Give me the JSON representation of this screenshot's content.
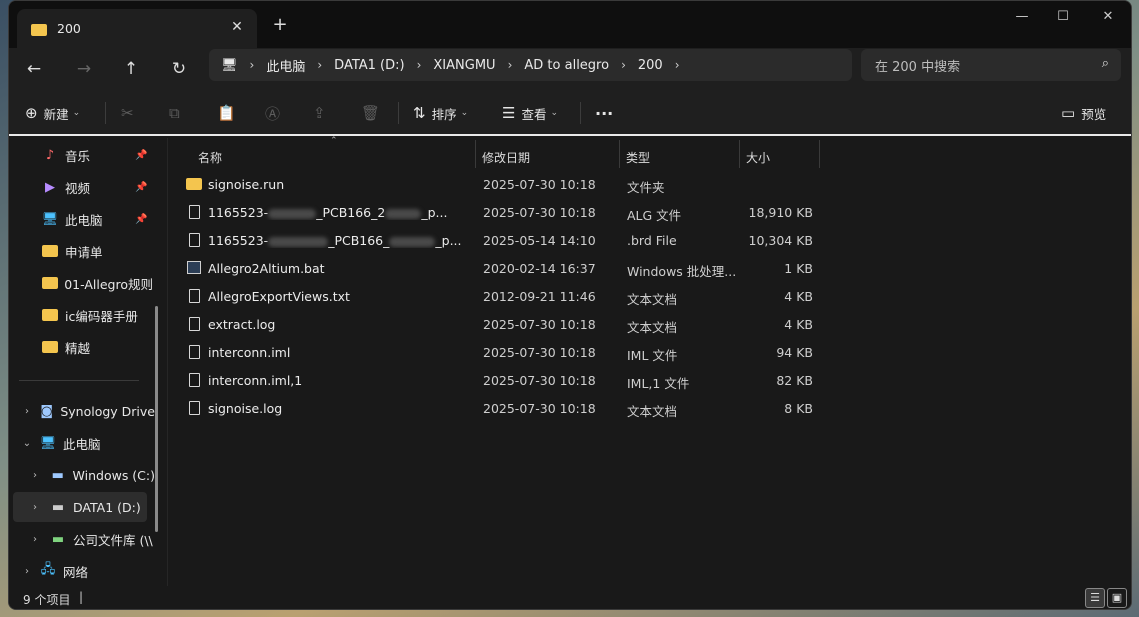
{
  "tab": {
    "title": "200",
    "close": "✕",
    "new_tab": "+"
  },
  "window_controls": {
    "minimize": "—",
    "maximize": "☐",
    "close": "✕"
  },
  "nav": {
    "back": "←",
    "forward": "→",
    "up": "↑",
    "refresh": "↻"
  },
  "breadcrumb": [
    "此电脑",
    "DATA1 (D:)",
    "XIANGMU",
    "AD to allegro",
    "200"
  ],
  "search": {
    "placeholder": "在 200 中搜索"
  },
  "toolbar": {
    "new_label": "新建",
    "sort_label": "排序",
    "view_label": "查看",
    "more_label": "···",
    "preview_label": "预览"
  },
  "sidebar": {
    "quick": [
      {
        "label": "音乐",
        "icon": "music-icon",
        "pinned": true
      },
      {
        "label": "视频",
        "icon": "video-icon",
        "pinned": true
      },
      {
        "label": "此电脑",
        "icon": "computer-icon",
        "pinned": true
      },
      {
        "label": "申请单",
        "icon": "folder-icon",
        "pinned": false
      },
      {
        "label": "01-Allegro规则",
        "icon": "folder-icon",
        "pinned": false
      },
      {
        "label": "ic编码器手册",
        "icon": "folder-icon",
        "pinned": false
      },
      {
        "label": "精越",
        "icon": "folder-icon",
        "pinned": false
      }
    ],
    "tree": [
      {
        "label": "Synology Drive",
        "icon": "synology-icon",
        "expanded": false
      },
      {
        "label": "此电脑",
        "icon": "computer-icon",
        "expanded": true
      },
      {
        "label": "Windows (C:)",
        "icon": "drive-icon",
        "expanded": false
      },
      {
        "label": "DATA1 (D:)",
        "icon": "drive-icon",
        "expanded": false
      },
      {
        "label": "公司文件库 (\\\\",
        "icon": "network-drive-icon",
        "expanded": false
      },
      {
        "label": "网络",
        "icon": "network-icon",
        "expanded": false
      }
    ]
  },
  "columns": {
    "name": "名称",
    "modified": "修改日期",
    "type": "类型",
    "size": "大小"
  },
  "files": [
    {
      "name": "signoise.run",
      "date": "2025-07-30 10:18",
      "type": "文件夹",
      "size": "",
      "kind": "folder"
    },
    {
      "name_prefix": "1165523-",
      "name_mid": "_PCB166_2",
      "name_suffix": "_p...",
      "date": "2025-07-30 10:18",
      "type": "ALG 文件",
      "size": "18,910 KB",
      "kind": "doc"
    },
    {
      "name_prefix": "1165523-",
      "name_mid": "_PCB166_",
      "name_suffix": "_p...",
      "date": "2025-05-14 14:10",
      "type": ".brd File",
      "size": "10,304 KB",
      "kind": "doc"
    },
    {
      "name": "Allegro2Altium.bat",
      "date": "2020-02-14 16:37",
      "type": "Windows 批处理...",
      "size": "1 KB",
      "kind": "bat"
    },
    {
      "name": "AllegroExportViews.txt",
      "date": "2012-09-21 11:46",
      "type": "文本文档",
      "size": "4 KB",
      "kind": "doc"
    },
    {
      "name": "extract.log",
      "date": "2025-07-30 10:18",
      "type": "文本文档",
      "size": "4 KB",
      "kind": "doc"
    },
    {
      "name": "interconn.iml",
      "date": "2025-07-30 10:18",
      "type": "IML 文件",
      "size": "94 KB",
      "kind": "doc"
    },
    {
      "name": "interconn.iml,1",
      "date": "2025-07-30 10:18",
      "type": "IML,1 文件",
      "size": "82 KB",
      "kind": "doc"
    },
    {
      "name": "signoise.log",
      "date": "2025-07-30 10:18",
      "type": "文本文档",
      "size": "8 KB",
      "kind": "doc"
    }
  ],
  "status": {
    "count": "9 个项目",
    "caret": "|"
  },
  "colors": {
    "folder": "#f4c54e",
    "accent": "#4cc2ff"
  }
}
